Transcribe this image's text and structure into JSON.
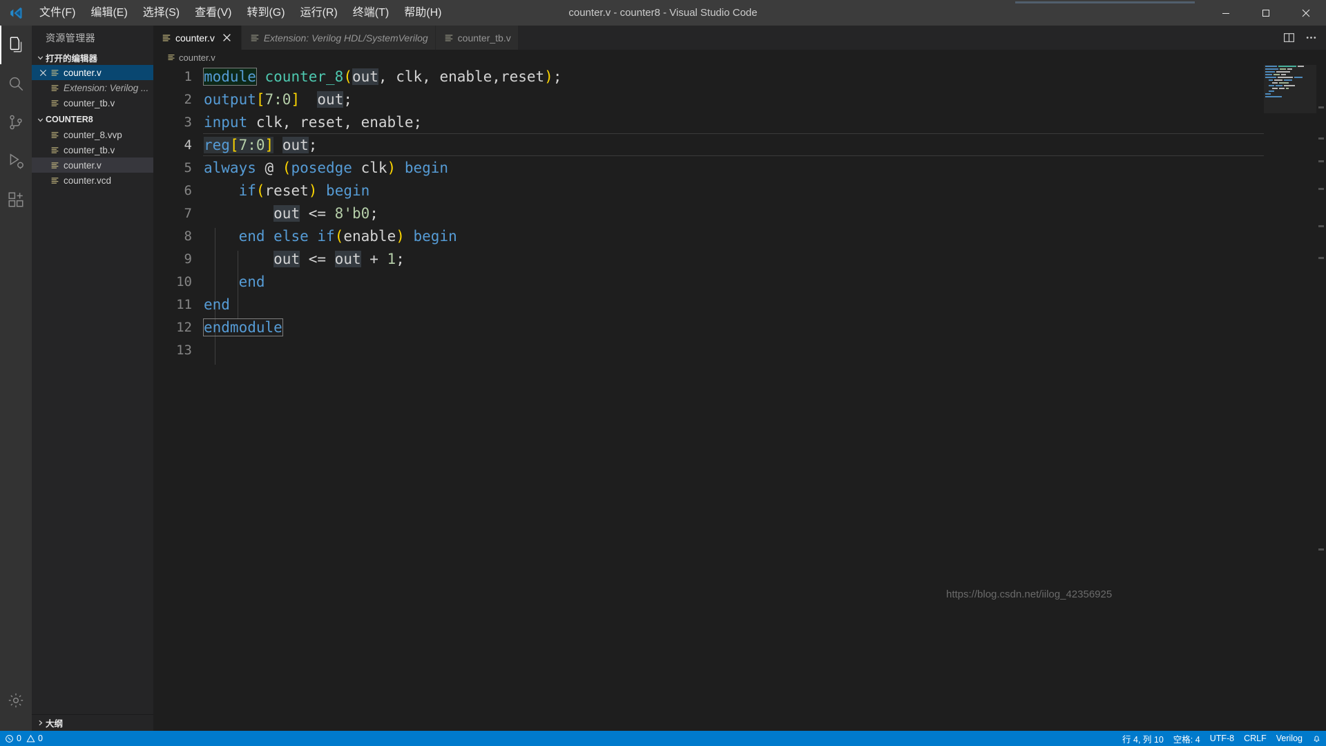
{
  "window": {
    "title": "counter.v - counter8 - Visual Studio Code",
    "logo_icon": "vscode-logo-icon",
    "controls": {
      "minimize": "minimize-icon",
      "maximize": "maximize-icon",
      "close": "close-icon"
    }
  },
  "menubar": {
    "items": [
      {
        "label": "文件(F)",
        "name": "menu-file"
      },
      {
        "label": "编辑(E)",
        "name": "menu-edit"
      },
      {
        "label": "选择(S)",
        "name": "menu-selection"
      },
      {
        "label": "查看(V)",
        "name": "menu-view"
      },
      {
        "label": "转到(G)",
        "name": "menu-go"
      },
      {
        "label": "运行(R)",
        "name": "menu-run"
      },
      {
        "label": "终端(T)",
        "name": "menu-terminal"
      },
      {
        "label": "帮助(H)",
        "name": "menu-help"
      }
    ]
  },
  "activitybar": {
    "items": [
      {
        "name": "activity-explorer",
        "icon": "files-icon",
        "active": true
      },
      {
        "name": "activity-search",
        "icon": "search-icon",
        "active": false
      },
      {
        "name": "activity-source-control",
        "icon": "source-control-icon",
        "active": false
      },
      {
        "name": "activity-run-debug",
        "icon": "run-debug-icon",
        "active": false
      },
      {
        "name": "activity-extensions",
        "icon": "extensions-icon",
        "active": false
      }
    ],
    "bottom": [
      {
        "name": "activity-manage",
        "icon": "gear-icon"
      }
    ]
  },
  "sidebar": {
    "title": "资源管理器",
    "sections": [
      {
        "name": "open-editors-section",
        "label": "打开的编辑器",
        "expanded": true,
        "twisty": "chevron-down-icon",
        "items": [
          {
            "label": "counter.v",
            "icon": "verilog-file-icon",
            "selected": true,
            "closable": true,
            "italic": false
          },
          {
            "label": "Extension: Verilog ...",
            "icon": "verilog-file-icon",
            "selected": false,
            "closable": false,
            "italic": true
          },
          {
            "label": "counter_tb.v",
            "icon": "verilog-file-icon",
            "selected": false,
            "closable": false,
            "italic": false
          }
        ]
      },
      {
        "name": "folder-section",
        "label": "COUNTER8",
        "expanded": true,
        "twisty": "chevron-down-icon",
        "items": [
          {
            "label": "counter_8.vvp",
            "icon": "verilog-file-icon",
            "selected": false,
            "closable": false,
            "italic": false
          },
          {
            "label": "counter_tb.v",
            "icon": "verilog-file-icon",
            "selected": false,
            "closable": false,
            "italic": false
          },
          {
            "label": "counter.v",
            "icon": "verilog-file-icon",
            "selected": false,
            "greyselected": true,
            "closable": false,
            "italic": false
          },
          {
            "label": "counter.vcd",
            "icon": "verilog-file-icon",
            "selected": false,
            "closable": false,
            "italic": false
          }
        ]
      }
    ],
    "outline": {
      "label": "大纲",
      "twisty": "chevron-right-icon",
      "name": "outline-section"
    }
  },
  "editor": {
    "tabs": [
      {
        "label": "counter.v",
        "icon": "verilog-file-icon",
        "active": true,
        "italic": false,
        "closable": true
      },
      {
        "label": "Extension: Verilog HDL/SystemVerilog",
        "icon": "verilog-file-icon",
        "active": false,
        "italic": true,
        "closable": false
      },
      {
        "label": "counter_tb.v",
        "icon": "verilog-file-icon",
        "active": false,
        "italic": false,
        "closable": false
      }
    ],
    "tab_actions": [
      {
        "name": "split-editor-button",
        "icon": "split-editor-icon"
      },
      {
        "name": "more-actions-button",
        "icon": "ellipsis-icon"
      }
    ],
    "breadcrumbs": [
      {
        "label": "counter.v",
        "icon": "verilog-file-icon"
      }
    ],
    "filename": "counter.v",
    "language": "Verilog",
    "total_lines": 13
  },
  "code": {
    "lines": [
      {
        "n": 1,
        "text": "module counter_8(out, clk, enable,reset);",
        "current": false
      },
      {
        "n": 2,
        "text": "output[7:0]  out;",
        "current": false
      },
      {
        "n": 3,
        "text": "input clk, reset, enable;",
        "current": false
      },
      {
        "n": 4,
        "text": "reg[7:0] out;",
        "current": true
      },
      {
        "n": 5,
        "text": "always @ (posedge clk) begin",
        "current": false
      },
      {
        "n": 6,
        "text": "    if(reset) begin",
        "current": false
      },
      {
        "n": 7,
        "text": "        out <= 8'b0;",
        "current": false
      },
      {
        "n": 8,
        "text": "    end else if(enable) begin",
        "current": false
      },
      {
        "n": 9,
        "text": "        out <= out + 1;",
        "current": false
      },
      {
        "n": 10,
        "text": "    end",
        "current": false
      },
      {
        "n": 11,
        "text": "end",
        "current": false
      },
      {
        "n": 12,
        "text": "endmodule",
        "current": false
      },
      {
        "n": 13,
        "text": "",
        "current": false
      }
    ]
  },
  "statusbar": {
    "left": [
      {
        "name": "status-problems",
        "icon": "error-warning-icon",
        "label": "0 ⚠ 0",
        "error_count": "0",
        "warning_count": "0"
      }
    ],
    "right": [
      {
        "name": "status-cursor-position",
        "label": "行 4, 列 10"
      },
      {
        "name": "status-indentation",
        "label": "空格: 4"
      },
      {
        "name": "status-encoding",
        "label": "UTF-8"
      },
      {
        "name": "status-eol",
        "label": "CRLF"
      },
      {
        "name": "status-language-mode",
        "label": "Verilog"
      },
      {
        "name": "status-notifications",
        "label": "",
        "icon": "bell-icon"
      }
    ]
  },
  "watermark": {
    "text": "https://blog.csdn.net/iilog_42356925"
  },
  "colors": {
    "accent": "#007acc",
    "titlebar_bg": "#3c3c3c",
    "sidebar_bg": "#252526",
    "editor_bg": "#1e1e1e",
    "activitybar_bg": "#333333",
    "selected_tree": "#094771",
    "keyword": "#569cd6",
    "module_name": "#4ec9b0",
    "bracket": "#ffd700",
    "number": "#b5cea8",
    "identifier": "#d4d4d4"
  }
}
